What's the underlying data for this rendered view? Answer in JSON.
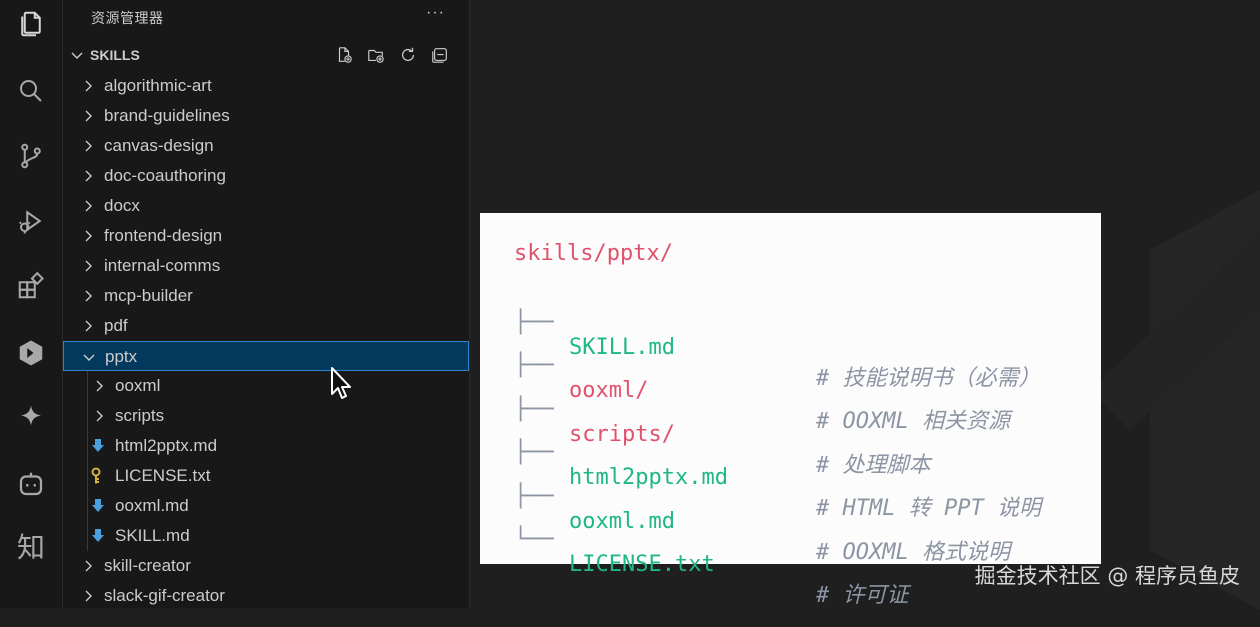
{
  "activity_bar": {
    "icons": [
      "explorer-icon",
      "search-icon",
      "source-control-icon",
      "run-debug-icon",
      "extensions-icon",
      "gitlens-icon",
      "copilot-icon",
      "assistant-icon",
      "zhihu-icon"
    ],
    "zhihu_label": "知"
  },
  "sidebar": {
    "title": "资源管理器",
    "more": "···",
    "section_title": "SKILLS",
    "items": [
      {
        "label": "algorithmic-art",
        "depth": 0,
        "type": "folder",
        "expanded": false
      },
      {
        "label": "brand-guidelines",
        "depth": 0,
        "type": "folder",
        "expanded": false
      },
      {
        "label": "canvas-design",
        "depth": 0,
        "type": "folder",
        "expanded": false
      },
      {
        "label": "doc-coauthoring",
        "depth": 0,
        "type": "folder",
        "expanded": false
      },
      {
        "label": "docx",
        "depth": 0,
        "type": "folder",
        "expanded": false
      },
      {
        "label": "frontend-design",
        "depth": 0,
        "type": "folder",
        "expanded": false
      },
      {
        "label": "internal-comms",
        "depth": 0,
        "type": "folder",
        "expanded": false
      },
      {
        "label": "mcp-builder",
        "depth": 0,
        "type": "folder",
        "expanded": false
      },
      {
        "label": "pdf",
        "depth": 0,
        "type": "folder",
        "expanded": false
      },
      {
        "label": "pptx",
        "depth": 0,
        "type": "folder",
        "expanded": true,
        "selected": true
      },
      {
        "label": "ooxml",
        "depth": 1,
        "type": "folder",
        "expanded": false
      },
      {
        "label": "scripts",
        "depth": 1,
        "type": "folder",
        "expanded": false
      },
      {
        "label": "html2pptx.md",
        "depth": 1,
        "type": "markdown"
      },
      {
        "label": "LICENSE.txt",
        "depth": 1,
        "type": "license"
      },
      {
        "label": "ooxml.md",
        "depth": 1,
        "type": "markdown"
      },
      {
        "label": "SKILL.md",
        "depth": 1,
        "type": "markdown"
      },
      {
        "label": "skill-creator",
        "depth": 0,
        "type": "folder",
        "expanded": false
      },
      {
        "label": "slack-gif-creator",
        "depth": 0,
        "type": "folder",
        "expanded": false
      }
    ]
  },
  "code_card": {
    "root": "skills/pptx/",
    "lines": [
      {
        "branch": "├──",
        "name": "SKILL.md",
        "color": "green",
        "comment": "# 技能说明书（必需）"
      },
      {
        "branch": "├──",
        "name": "ooxml/",
        "color": "red",
        "comment": "# OOXML 相关资源"
      },
      {
        "branch": "├──",
        "name": "scripts/",
        "color": "red",
        "comment": "# 处理脚本"
      },
      {
        "branch": "├──",
        "name": "html2pptx.md",
        "color": "green",
        "comment": "# HTML 转 PPT 说明"
      },
      {
        "branch": "├──",
        "name": "ooxml.md",
        "color": "green",
        "comment": "# OOXML 格式说明"
      },
      {
        "branch": "└──",
        "name": "LICENSE.txt",
        "color": "green",
        "comment": "# 许可证"
      }
    ]
  },
  "footer": {
    "credit": "掘金技术社区 @ 程序员鱼皮"
  },
  "colors": {
    "accent": "#2f7fd0",
    "selected_bg": "#04395e",
    "green": "#1fb784",
    "red": "#e0526b"
  }
}
